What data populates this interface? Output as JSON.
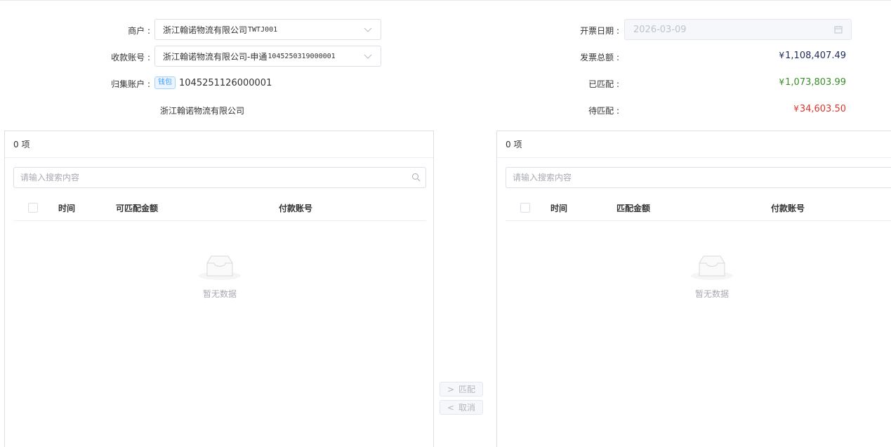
{
  "form": {
    "merchant": {
      "label": "商户 :",
      "name": "浙江翰诺物流有限公司",
      "code": "TWTJ001"
    },
    "receive_account": {
      "label": "收款账号 :",
      "name": "浙江翰诺物流有限公司-申通",
      "code": "1045250319000001"
    },
    "collect_account": {
      "label": "归集账户 :",
      "tag": "钱包",
      "number": "1045251126000001",
      "company": "浙江翰诺物流有限公司"
    },
    "invoice_date": {
      "label": "开票日期 :",
      "value": "2026-03-09"
    },
    "invoice_total": {
      "label": "发票总额 :",
      "currency": "¥",
      "value": "1,108,407.49",
      "color": "#1d2b5a"
    },
    "matched": {
      "label": "已匹配 :",
      "currency": "¥",
      "value": "1,073,803.99",
      "color": "#3a8e28"
    },
    "pending": {
      "label": "待匹配 :",
      "currency": "¥",
      "value": "34,603.50",
      "color": "#e0352b"
    }
  },
  "left_panel": {
    "count": "0 项",
    "search_placeholder": "请输入搜索内容",
    "columns": [
      "时间",
      "可匹配金额",
      "付款账号"
    ],
    "empty_text": "暂无数据"
  },
  "right_panel": {
    "count": "0 项",
    "search_placeholder": "请输入搜索内容",
    "columns": [
      "时间",
      "匹配金额",
      "付款账号"
    ],
    "empty_text": "暂无数据"
  },
  "transfer": {
    "match_label": "匹配",
    "cancel_label": "取消",
    "match_arrow": ">",
    "cancel_arrow": "<"
  },
  "icons": {
    "dropdown": "chevron-down-icon",
    "date": "calendar-icon",
    "search": "search-icon",
    "empty": "empty-inbox-icon"
  }
}
